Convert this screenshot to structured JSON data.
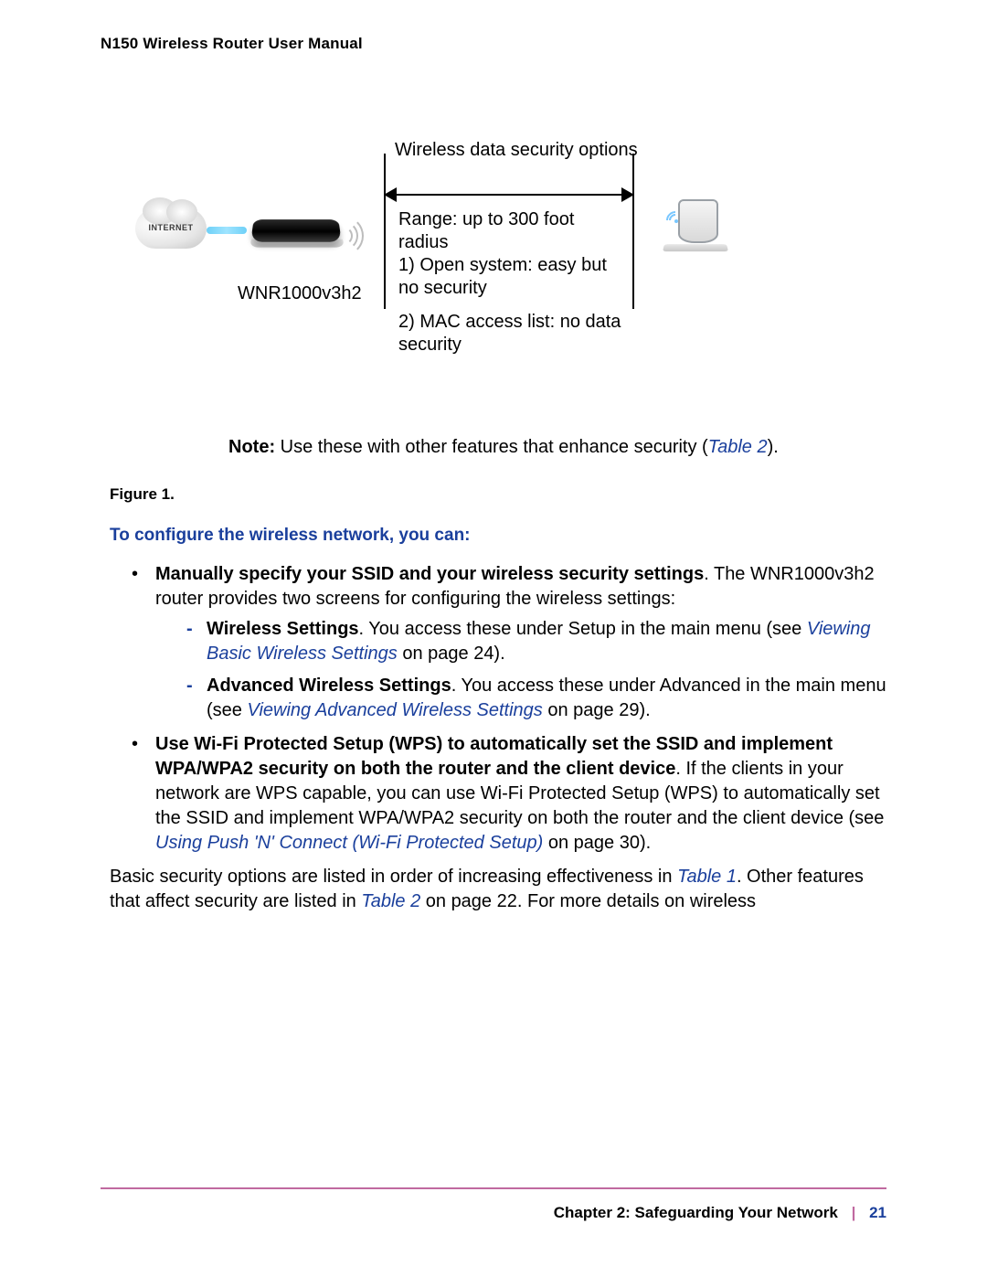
{
  "header": {
    "title": "N150 Wireless Router User Manual"
  },
  "diagram": {
    "internet_label": "INTERNET",
    "router_model": "WNR1000v3h2",
    "heading": "Wireless data security options",
    "range": "Range: up to 300 foot radius",
    "option1": "1) Open system: easy but no security",
    "option2": "2) MAC access list: no data security"
  },
  "note": {
    "prefix": "Note:",
    "text_before": " Use these with other features that enhance security (",
    "xref": "Table 2",
    "text_after": ")."
  },
  "figure_caption": "Figure 1.",
  "subheading": "To configure the wireless network, you can:",
  "bullet1": {
    "bold": "Manually specify your SSID and your wireless security settings",
    "rest": ". The WNR1000v3h2 router provides two screens for configuring the wireless settings:"
  },
  "sub1": {
    "bold": "Wireless Settings",
    "rest_before": ". You access these under Setup in the main menu (see ",
    "xref": "Viewing Basic Wireless Settings",
    "rest_after": " on page 24)."
  },
  "sub2": {
    "bold": "Advanced Wireless Settings",
    "rest_before": ". You access these under Advanced in the main menu (see ",
    "xref": "Viewing Advanced Wireless Settings",
    "rest_after": " on page 29)."
  },
  "bullet2": {
    "bold": "Use Wi-Fi Protected Setup (WPS) to automatically set the SSID and implement WPA/WPA2 security on both the router and the client device",
    "rest_before": ". If the clients in your network are WPS capable, you can use Wi-Fi Protected Setup (WPS) to automatically set the SSID and implement WPA/WPA2 security on both the router and the client device (see ",
    "xref": "Using Push 'N' Connect (Wi-Fi Protected Setup)",
    "rest_after": " on page 30)."
  },
  "closing": {
    "before1": "Basic security options are listed in order of increasing effectiveness in ",
    "xref1": "Table 1",
    "mid": ". Other features that affect security are listed in ",
    "xref2": "Table 2",
    "after": " on page 22. For more details on wireless"
  },
  "footer": {
    "chapter": "Chapter 2:  Safeguarding Your Network",
    "page": "21"
  }
}
